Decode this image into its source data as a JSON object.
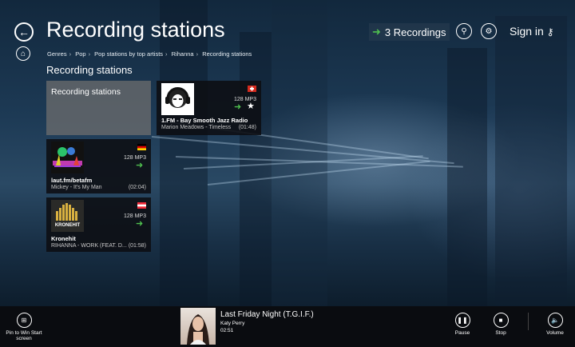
{
  "header": {
    "title": "Recording stations",
    "recordings_label": "3 Recordings",
    "signin_label": "Sign in"
  },
  "breadcrumb": [
    "Genres",
    "Pop",
    "Pop stations by top artists",
    "Rihanna",
    "Recording stations"
  ],
  "section_title": "Recording stations",
  "tiles": [
    {
      "name": "Recording stations"
    },
    {
      "name": "1.FM - Bay Smooth Jazz Radio",
      "quality": "128 MP3",
      "track": "Marion Meadows - Timeless",
      "duration": "(01:48)"
    },
    {
      "name": "laut.fm/betafm",
      "quality": "128 MP3",
      "track": "Mickey - It's My Man",
      "duration": "(02:04)"
    },
    {
      "name": "Kronehit",
      "quality": "128 MP3",
      "track": "RIHANNA - WORK (FEAT. D...",
      "duration": "(01:58)",
      "logo_text": "KRONEHIT"
    }
  ],
  "now_playing": {
    "title": "Last Friday Night (T.G.I.F.)",
    "artist": "Katy Perry",
    "time": "02:51"
  },
  "bottom_bar": {
    "pin_label": "Pin to Win Start screen",
    "pause_label": "Pause",
    "stop_label": "Stop",
    "volume_label": "Volume"
  },
  "colors": {
    "accent_green": "#4fbf4f",
    "tile_dark": "#0c0e12",
    "bottom_bar": "#0a0c10"
  },
  "icons": [
    "back-icon",
    "home-icon",
    "search-icon",
    "gear-icon",
    "key-icon",
    "arrow-right-icon",
    "star-icon",
    "pin-icon",
    "pause-icon",
    "stop-icon",
    "volume-icon"
  ]
}
